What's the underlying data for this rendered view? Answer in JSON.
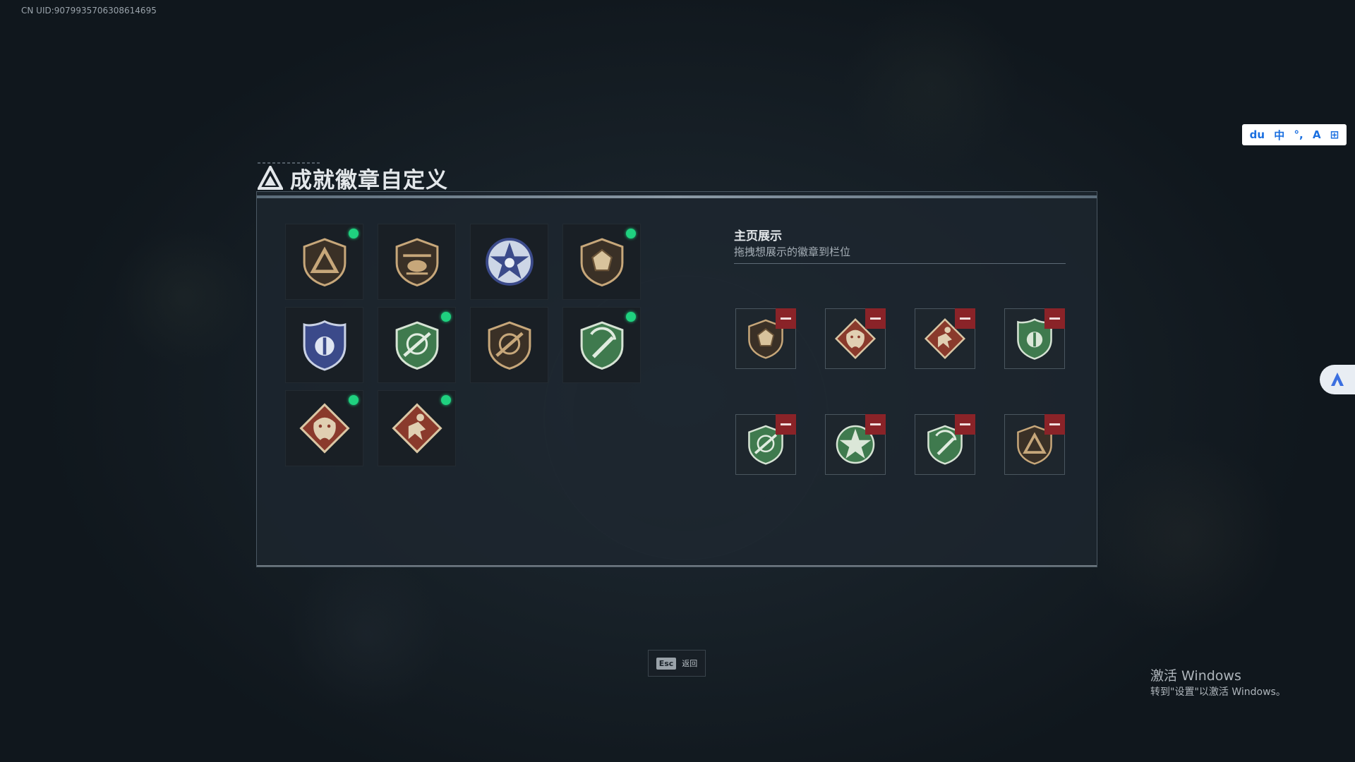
{
  "uid": "CN UID:9079935706308614695",
  "title": "成就徽章自定义",
  "showcase": {
    "title": "主页展示",
    "subtitle": "拖拽想展示的徽章到栏位"
  },
  "collection": [
    {
      "icon": "tan-triangle-shield-badge",
      "new": true
    },
    {
      "icon": "helicopter-badge",
      "new": false
    },
    {
      "icon": "blue-star-badge",
      "new": false
    },
    {
      "icon": "gem-shield-badge",
      "new": true
    },
    {
      "icon": "blue-police-badge",
      "new": false
    },
    {
      "icon": "green-rifle-badge",
      "new": true
    },
    {
      "icon": "tan-rifle-badge",
      "new": false
    },
    {
      "icon": "green-knife-badge",
      "new": true
    },
    {
      "icon": "red-dragon-badge",
      "new": true
    },
    {
      "icon": "red-runner-badge",
      "new": true
    }
  ],
  "display_slots": [
    {
      "icon": "gem-shield-badge"
    },
    {
      "icon": "red-dragon-badge"
    },
    {
      "icon": "red-runner-badge"
    },
    {
      "icon": "green-police-badge"
    },
    {
      "icon": "green-rifle-badge"
    },
    {
      "icon": "green-star-badge"
    },
    {
      "icon": "green-knife-badge"
    },
    {
      "icon": "tan-triangle-shield-badge"
    }
  ],
  "esc": {
    "key": "Esc",
    "label": "返回"
  },
  "windows_watermark": {
    "title": "激活 Windows",
    "subtitle": "转到\"设置\"以激活 Windows。"
  },
  "ime": [
    "du",
    "中",
    "°,",
    "A",
    "⊞"
  ],
  "colors": {
    "new_dot": "#1fd17f",
    "remove": "#8a2328",
    "tan": "#c7a77a",
    "green": "#3f7a4e",
    "red": "#8a3a2c",
    "blue": "#3b4a8a"
  }
}
